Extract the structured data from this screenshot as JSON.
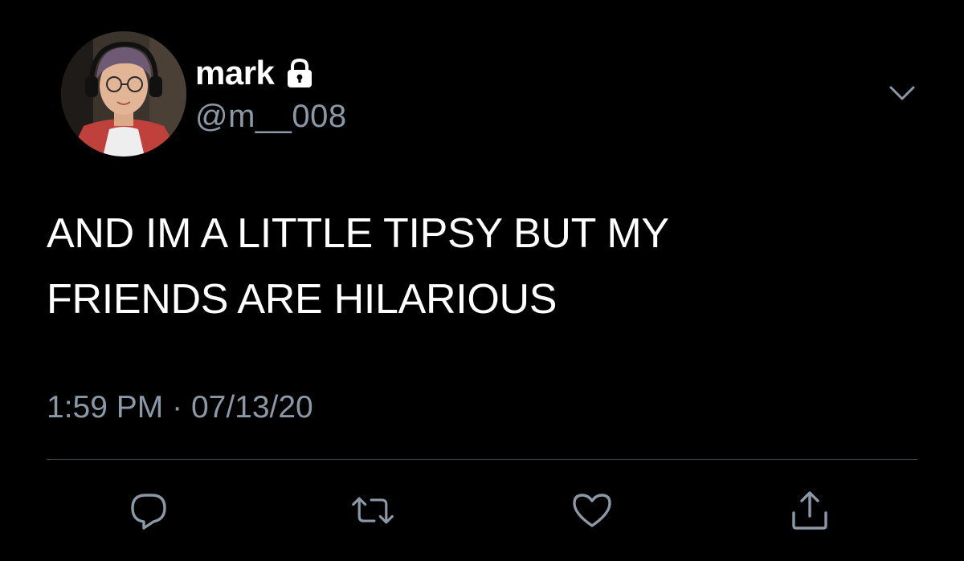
{
  "user": {
    "display_name": "mark",
    "handle": "@m__008",
    "avatar_icon": "profile-photo",
    "protected_icon": "lock-icon"
  },
  "tweet": {
    "text_line_1": "AND IM A LITTLE TIPSY BUT MY",
    "text_line_2": "FRIENDS ARE HILARIOUS",
    "time": "1:59 PM",
    "separator": "·",
    "date": "07/13/20"
  },
  "actions": {
    "reply_icon": "reply-icon",
    "retweet_icon": "retweet-icon",
    "like_icon": "heart-icon",
    "share_icon": "share-icon",
    "more_icon": "chevron-down-icon"
  },
  "colors": {
    "background": "#000000",
    "primary_text": "#ffffff",
    "secondary_text": "#8b98a5",
    "divider": "#38444d"
  }
}
